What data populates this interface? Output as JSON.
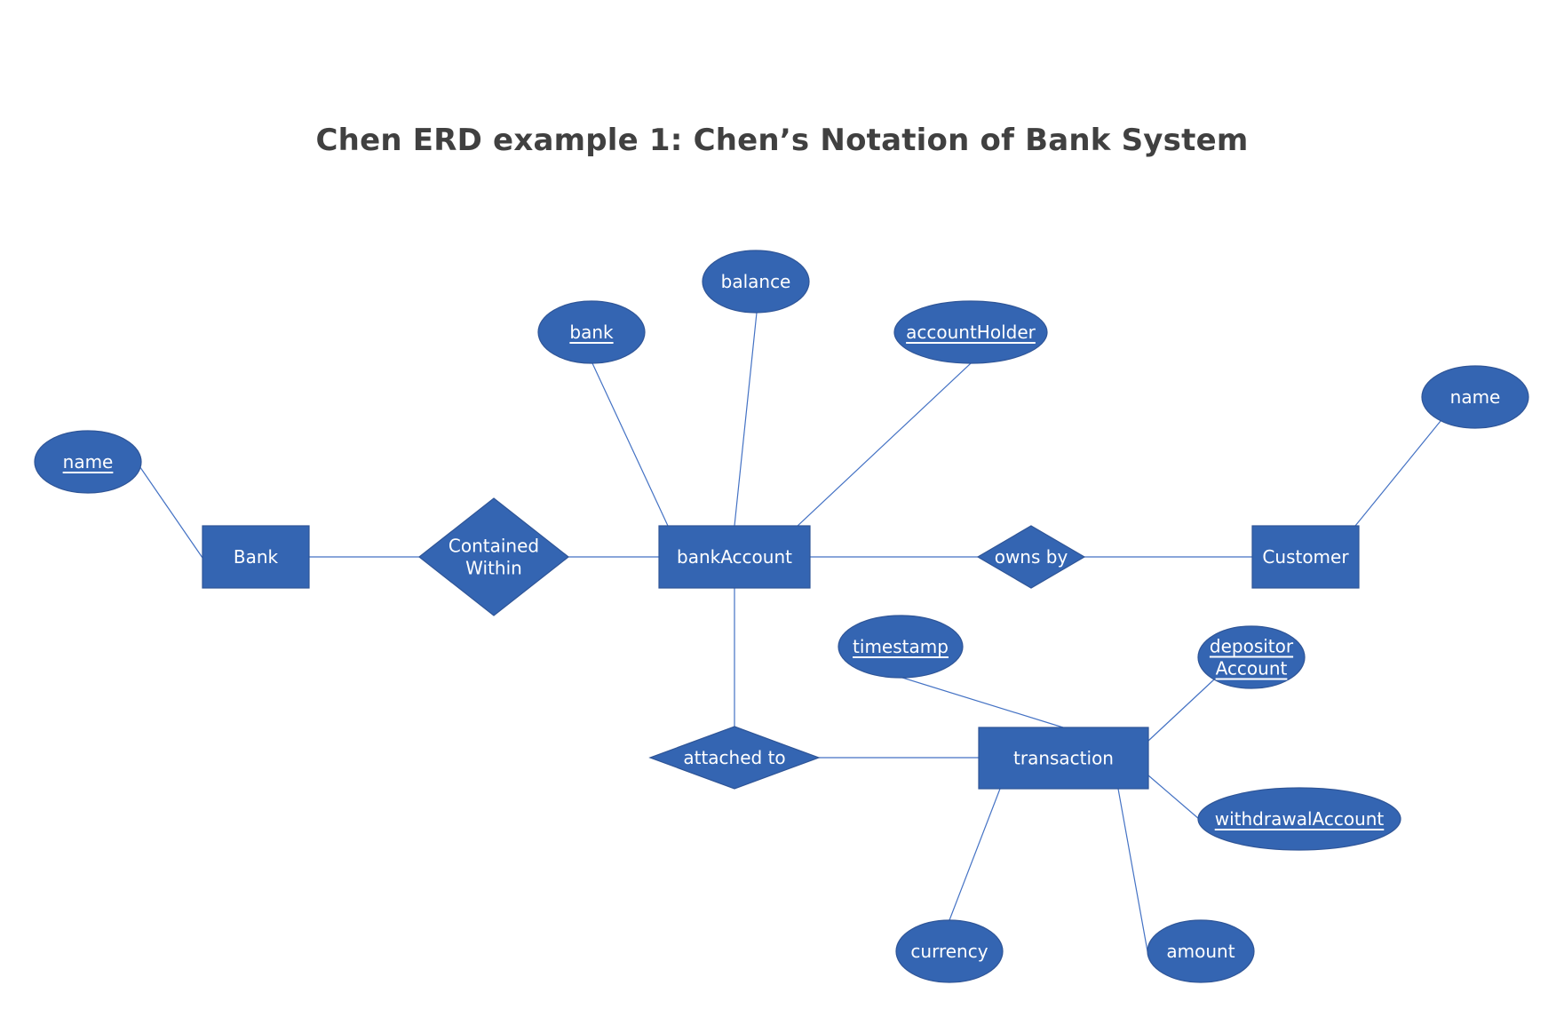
{
  "title": "Chen ERD example 1: Chen’s Notation of Bank System",
  "colors": {
    "shape_fill": "#3465B2",
    "shape_border": "#2F5597",
    "connector": "#4472C4",
    "label_text": "#FFFFFF",
    "title_text": "#404040"
  },
  "entities": [
    {
      "id": "bank",
      "label": "Bank"
    },
    {
      "id": "bankAccount",
      "label": "bankAccount"
    },
    {
      "id": "customer",
      "label": "Customer"
    },
    {
      "id": "transaction",
      "label": "transaction"
    }
  ],
  "relationships": [
    {
      "id": "containedWithin",
      "label_lines": [
        "Contained",
        "Within"
      ],
      "connects": [
        "bank",
        "bankAccount"
      ]
    },
    {
      "id": "ownsBy",
      "label_lines": [
        "owns by"
      ],
      "connects": [
        "bankAccount",
        "customer"
      ]
    },
    {
      "id": "attachedTo",
      "label_lines": [
        "attached to"
      ],
      "connects": [
        "bankAccount",
        "transaction"
      ]
    }
  ],
  "attributes": [
    {
      "id": "bankName",
      "label_lines": [
        "name"
      ],
      "key": true,
      "entity": "bank"
    },
    {
      "id": "acctBank",
      "label_lines": [
        "bank"
      ],
      "key": true,
      "entity": "bankAccount"
    },
    {
      "id": "balance",
      "label_lines": [
        "balance"
      ],
      "key": false,
      "entity": "bankAccount"
    },
    {
      "id": "accountHolder",
      "label_lines": [
        "accountHolder"
      ],
      "key": true,
      "entity": "bankAccount"
    },
    {
      "id": "customerName",
      "label_lines": [
        "name"
      ],
      "key": false,
      "entity": "customer"
    },
    {
      "id": "timestamp",
      "label_lines": [
        "timestamp"
      ],
      "key": true,
      "entity": "transaction"
    },
    {
      "id": "depositorAccount",
      "label_lines": [
        "depositor",
        "Account"
      ],
      "key": true,
      "entity": "transaction"
    },
    {
      "id": "withdrawalAccount",
      "label_lines": [
        "withdrawalAccount"
      ],
      "key": true,
      "entity": "transaction"
    },
    {
      "id": "currency",
      "label_lines": [
        "currency"
      ],
      "key": false,
      "entity": "transaction"
    },
    {
      "id": "amount",
      "label_lines": [
        "amount"
      ],
      "key": false,
      "entity": "transaction"
    }
  ]
}
